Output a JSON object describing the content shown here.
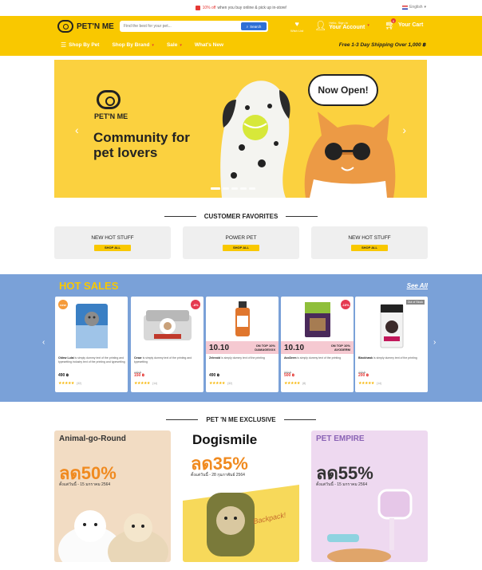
{
  "promo": {
    "highlight": "10% off",
    "text": "when you buy online & pick up in-store!",
    "lang": "English"
  },
  "header": {
    "logo": "PET'N ME",
    "search_placeholder": "Find the best for your pet...",
    "search_button": "Search",
    "wishlist": "Wish List",
    "account_small": "Hello, Sign in",
    "account_big": "Your Account",
    "cart_label": "Your Cart",
    "cart_count": "0",
    "nav": [
      "Shop By Pet",
      "Shop By Brand",
      "Sale",
      "What's New"
    ],
    "shipping": "Free 1-3 Day Shipping Over 1,000 ฿"
  },
  "hero": {
    "brand": "PET'N ME",
    "title": "Community for pet lovers",
    "bubble": "Now Open!"
  },
  "favorites": {
    "title": "CUSTOMER FAVORITES",
    "cards": [
      {
        "name": "NEW HOT STUFF",
        "button": "SHOP ALL"
      },
      {
        "name": "POWER PET",
        "button": "SHOP ALL"
      },
      {
        "name": "NEW HOT STUFF",
        "button": "SHOP ALL"
      }
    ]
  },
  "hot_sales": {
    "title": "HOT SALES",
    "see_all": "See All",
    "products": [
      {
        "badge": "new",
        "brand": "Oldew Lulai",
        "desc": "is simply dummy text of the printing and typesetting industry text of the printing and typesetting",
        "price": "490 ฿",
        "old": "",
        "rating_count": "(32)",
        "deal": false
      },
      {
        "badge": "-8%",
        "brand": "Cesar",
        "desc": "is simply dummy text of the printing and typesetting",
        "price": "150 ฿",
        "old": "165 ฿",
        "rating_count": "(14)",
        "deal": false
      },
      {
        "badge": "",
        "brand": "Zelevoid",
        "desc": "is simply dummy text of the printing",
        "price": "490 ฿",
        "old": "",
        "rating_count": "(32)",
        "deal": true,
        "deal_big": "10.10",
        "deal_top": "ON TOP 10%",
        "deal_bottom": "DAMAGEXXX"
      },
      {
        "badge": "-10%",
        "brand": "AvoDerm",
        "desc": "is simply dummy text of the printing",
        "price": "500 ฿",
        "old": "550 ฿",
        "rating_count": "(8)",
        "deal": true,
        "deal_big": "10.10",
        "deal_top": "ON TOP 10%",
        "deal_bottom": "AVODERM"
      },
      {
        "badge": "Out of Stock",
        "brand": "Blackhawk",
        "desc": "is simply dummy text of the printing",
        "price": "200 ฿",
        "old": "220 ฿",
        "rating_count": "(14)",
        "deal": false
      }
    ]
  },
  "exclusive": {
    "title": "PET 'N ME EXCLUSIVE",
    "cards": [
      {
        "title": "Animal-go-Round",
        "pct": "ลด50%",
        "date": "ตั้งแต่วันนี้ - 15 มกราคม 2564"
      },
      {
        "title": "Dogismile",
        "pct": "ลด35%",
        "date": "ตั้งแต่วันนี้ - 28 กุมภาพันธ์ 2564",
        "tag": "Backpack!"
      },
      {
        "title": "PET EMPIRE",
        "pct": "ลด55%",
        "date": "ตั้งแต่วันนี้ - 15 มกราคม 2564"
      }
    ]
  }
}
